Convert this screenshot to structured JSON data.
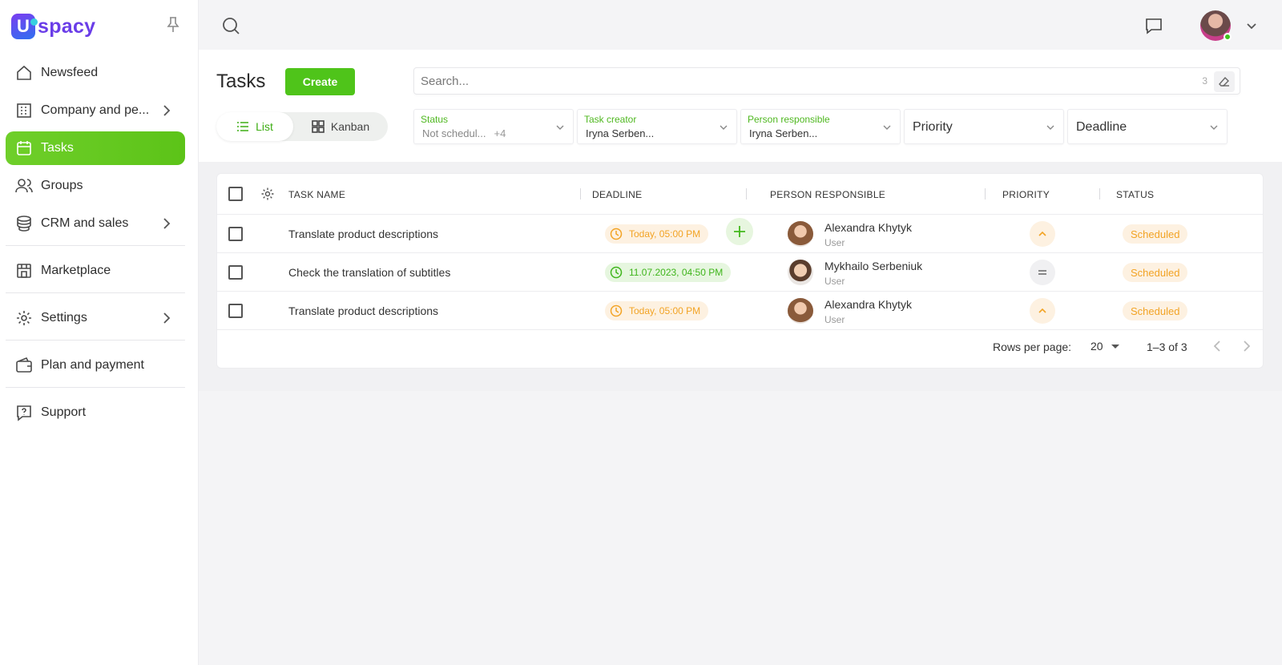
{
  "app": {
    "logo_letter": "U",
    "logo_text": "spacy"
  },
  "sidebar": {
    "items": [
      {
        "label": "Newsfeed"
      },
      {
        "label": "Company and pe..."
      },
      {
        "label": "Tasks"
      },
      {
        "label": "Groups"
      },
      {
        "label": "CRM and sales"
      },
      {
        "label": "Marketplace"
      },
      {
        "label": "Settings"
      },
      {
        "label": "Plan and payment"
      },
      {
        "label": "Support"
      }
    ]
  },
  "header": {
    "title": "Tasks",
    "create_label": "Create",
    "view_list": "List",
    "view_kanban": "Kanban",
    "search_placeholder": "Search...",
    "search_count": "3"
  },
  "filters": {
    "status": {
      "label": "Status",
      "value": "Not schedul...",
      "extra": "+4"
    },
    "creator": {
      "label": "Task creator",
      "value": "Iryna Serben..."
    },
    "responsible": {
      "label": "Person responsible",
      "value": "Iryna Serben..."
    },
    "priority": {
      "placeholder": "Priority"
    },
    "deadline": {
      "placeholder": "Deadline"
    }
  },
  "table": {
    "columns": {
      "task_name": "TASK NAME",
      "deadline": "DEADLINE",
      "person": "PERSON RESPONSIBLE",
      "priority": "PRIORITY",
      "status": "STATUS"
    },
    "rows": [
      {
        "name": "Translate product descriptions",
        "deadline": "Today, 05:00 PM",
        "person": "Alexandra Khytyk",
        "role": "User",
        "priority": "high",
        "status": "Scheduled"
      },
      {
        "name": "Check the translation of subtitles",
        "deadline": "11.07.2023, 04:50 PM",
        "person": "Mykhailo Serbeniuk",
        "role": "User",
        "priority": "medium",
        "status": "Scheduled"
      },
      {
        "name": "Translate product descriptions",
        "deadline": "Today, 05:00 PM",
        "person": "Alexandra Khytyk",
        "role": "User",
        "priority": "high",
        "status": "Scheduled"
      }
    ]
  },
  "pager": {
    "rows_per_page_label": "Rows per page:",
    "rows_per_page": "20",
    "range": "1–3 of 3"
  },
  "colors": {
    "accent": "#4fc41a",
    "warning": "#f2a324",
    "brand": "#6a3de8"
  },
  "icons": {
    "pin": "pin-icon",
    "search": "search-icon",
    "chat": "chat-icon",
    "chevron": "chevron-down-icon",
    "gear": "gear-icon",
    "clock": "clock-icon",
    "plus": "plus-icon"
  }
}
